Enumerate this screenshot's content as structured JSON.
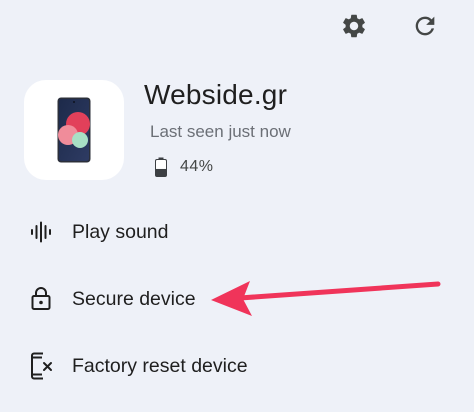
{
  "toolbar": {
    "settings_icon": "gear-icon",
    "refresh_icon": "refresh-icon"
  },
  "device": {
    "name": "Webside.gr",
    "status": "Last seen just now",
    "battery": "44%",
    "battery_level_percent": 44,
    "image_icon": "phone-icon"
  },
  "actions": [
    {
      "label": "Play sound",
      "icon": "sound-wave-icon"
    },
    {
      "label": "Secure device",
      "icon": "lock-icon"
    },
    {
      "label": "Factory reset device",
      "icon": "phone-erase-icon"
    }
  ],
  "colors": {
    "background": "#eef1f8",
    "card": "#ffffff",
    "annotation_arrow": "#f0345a"
  }
}
